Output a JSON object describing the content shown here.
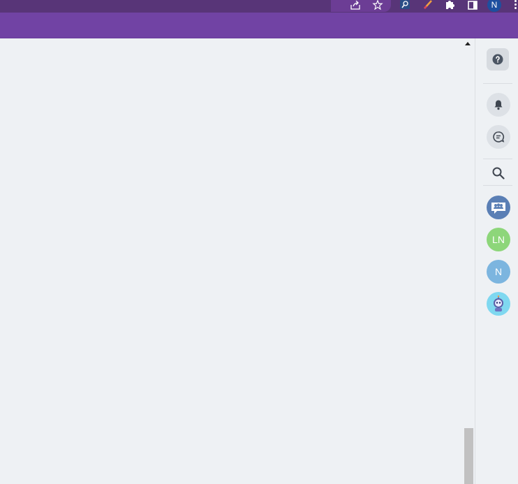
{
  "browser": {
    "profile_initial": "N"
  },
  "rail": {
    "ln_initials": "LN",
    "n_initial": "N"
  },
  "colors": {
    "header": "#7143a4",
    "chrome": "#583578",
    "background": "#eef1f4",
    "ln_avatar": "#8dd67a",
    "n_avatar": "#7cb5df"
  }
}
